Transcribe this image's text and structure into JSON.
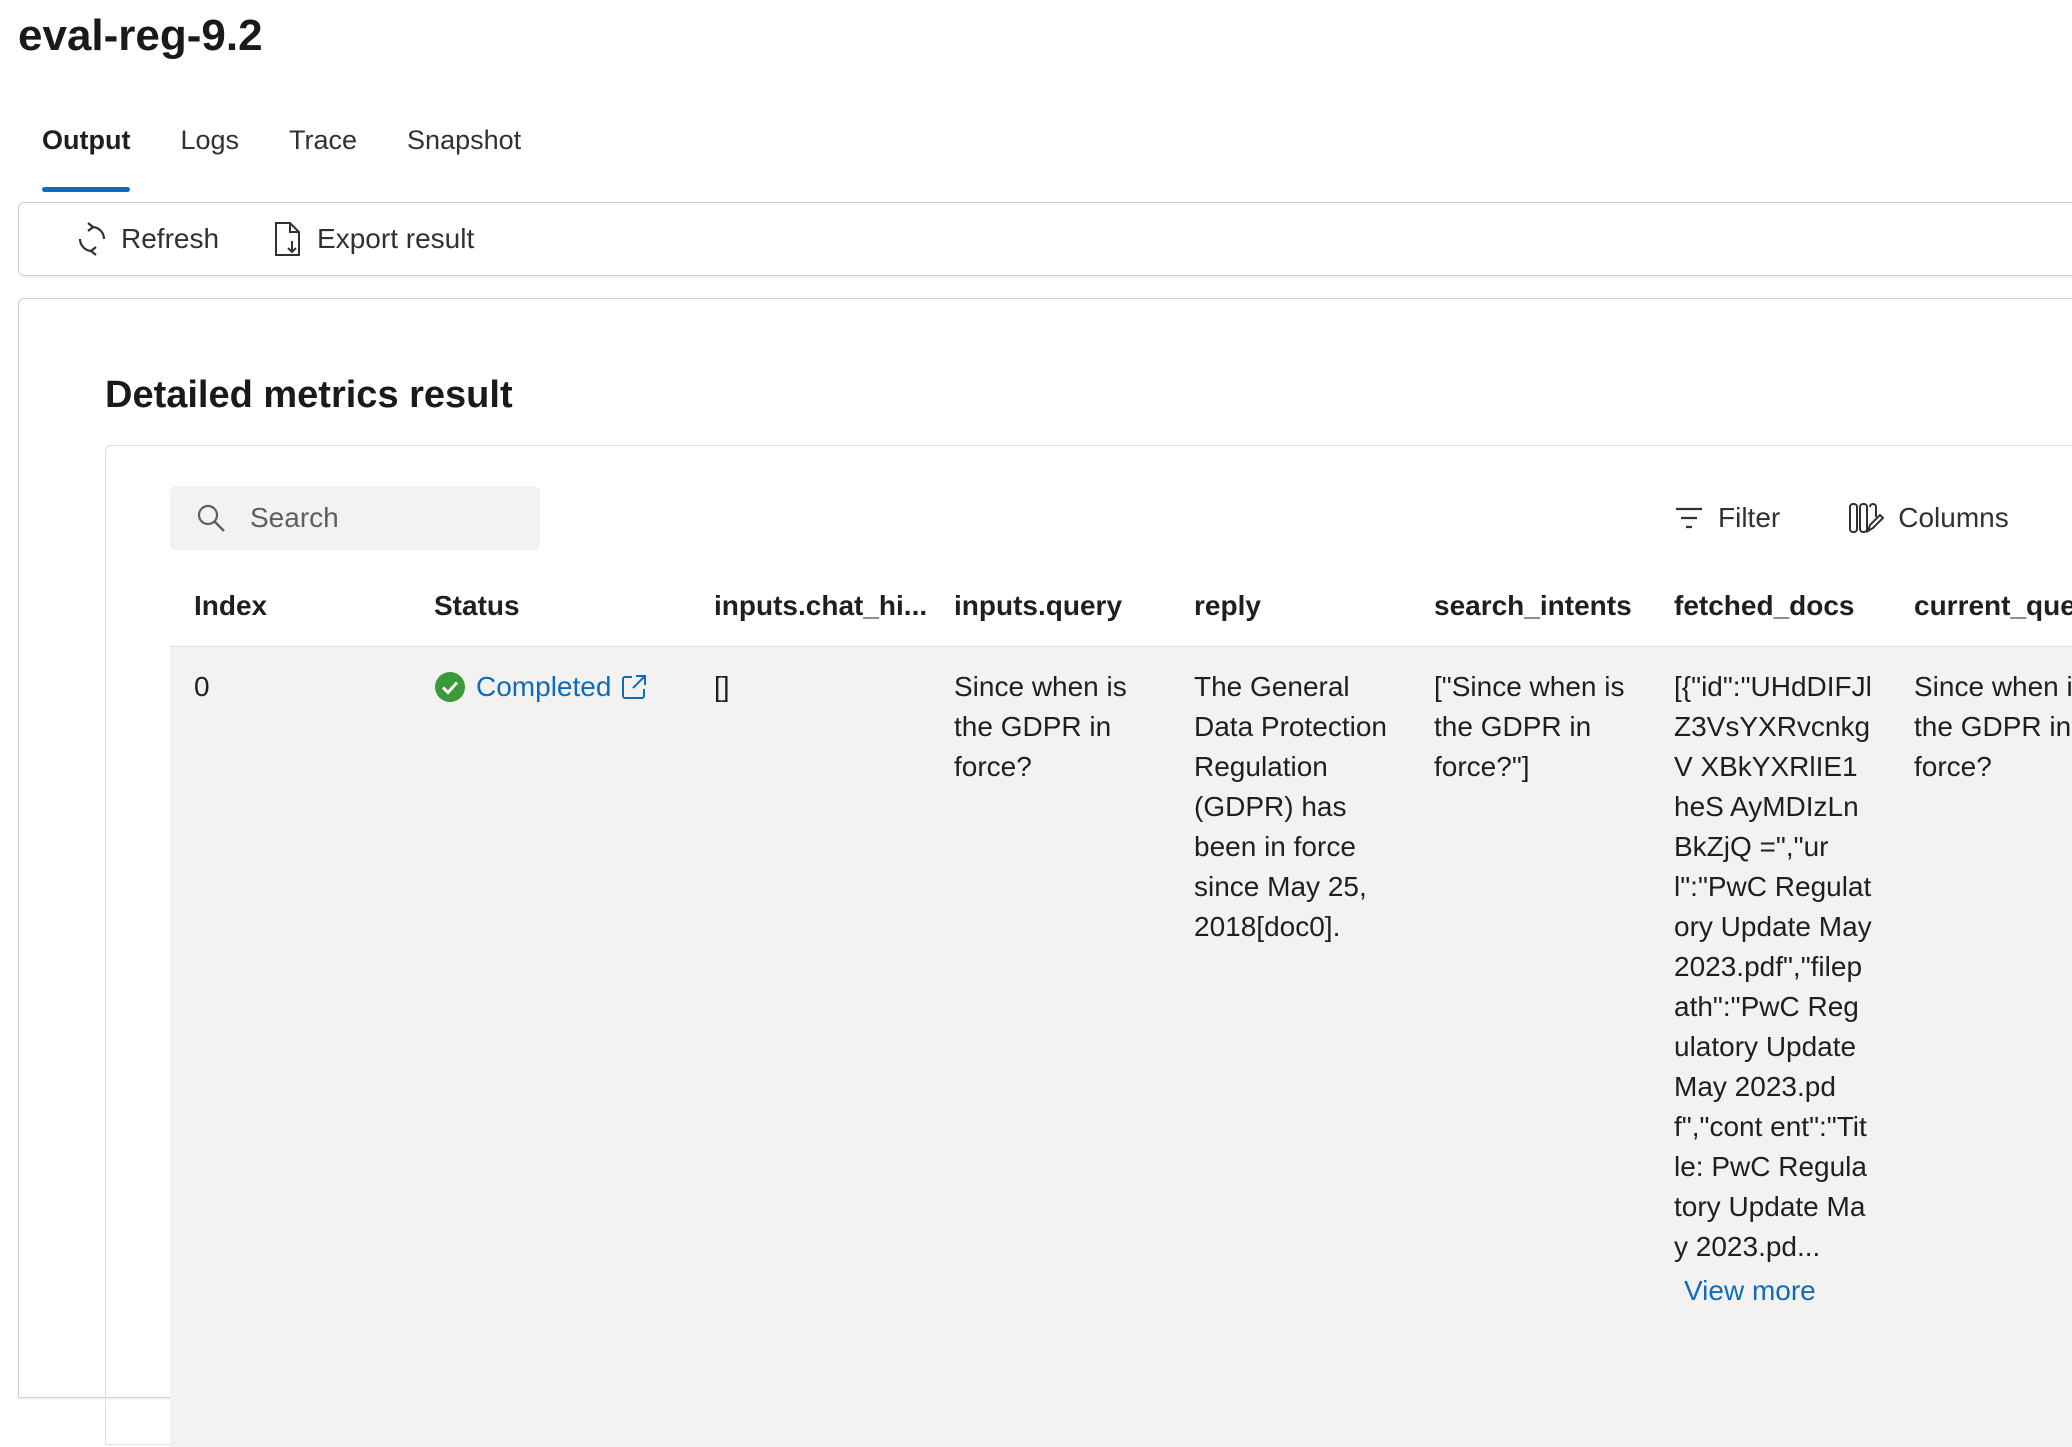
{
  "page": {
    "title": "eval-reg-9.2"
  },
  "tabs": [
    {
      "label": "Output"
    },
    {
      "label": "Logs"
    },
    {
      "label": "Trace"
    },
    {
      "label": "Snapshot"
    }
  ],
  "toolbar": {
    "refresh_label": "Refresh",
    "export_label": "Export result"
  },
  "metrics": {
    "title": "Detailed metrics result",
    "search_placeholder": "Search",
    "filter_label": "Filter",
    "columns_label": "Columns",
    "headers": [
      "Index",
      "Status",
      "inputs.chat_hi...",
      "inputs.query",
      "reply",
      "search_intents",
      "fetched_docs",
      "current_que"
    ],
    "rows": [
      {
        "index": "0",
        "status": "Completed",
        "chat_history": "[]",
        "query": "Since when is the GDPR in force?",
        "reply": "The General Data Protection Regulation (GDPR) has been in force since May 25, 2018[doc0].",
        "search_intents": "[\"Since when is the GDPR in force?\"]",
        "fetched_docs": "[{\"id\":\"UHdDIFJl Z3VsYXRvcnkgV XBkYXRlIE1heS AyMDIzLnBkZjQ =\",\"url\":\"PwC Regulatory Update May 2023.pdf\",\"filep ath\":\"PwC Regulatory Update May 2023.pdf\",\"cont ent\":\"Title: PwC Regulatory Update May 2023.pd...",
        "view_more": "View more",
        "current_query": "Since when is the GDPR in force?"
      }
    ]
  },
  "colors": {
    "accent": "#0f6cbd",
    "success": "#3a9a3a",
    "row_bg": "#f3f2f1"
  },
  "icons": {
    "refresh": "refresh-icon",
    "export": "export-document-icon",
    "search": "search-icon",
    "filter": "filter-icon",
    "columns": "columns-icon",
    "status": "check-circle-icon",
    "open": "open-external-icon"
  }
}
